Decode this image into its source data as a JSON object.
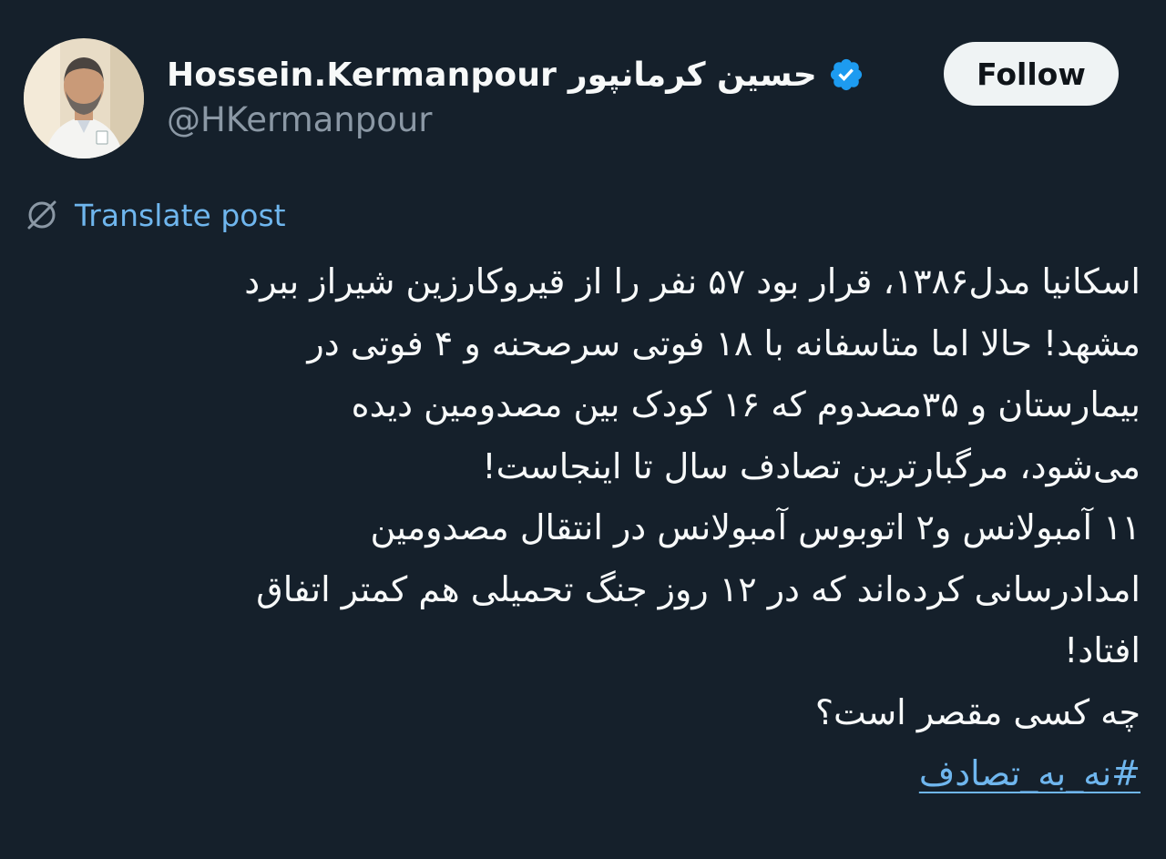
{
  "author": {
    "display_name": "Hossein.Kermanpour حسین کرمانپور",
    "handle": "@HKermanpour",
    "verified": true,
    "avatar": "avatar-photo",
    "verified_icon": "verified-badge-icon"
  },
  "follow_button": {
    "label": "Follow"
  },
  "translate": {
    "label": "Translate post",
    "icon": "globe-slash-icon"
  },
  "tweet": {
    "lines": [
      "اسکانیا مدل۱۳۸۶، قرار بود ۵۷ نفر را از قیروکارزین شیراز ببرد",
      "مشهد! حالا اما متاسفانه با ۱۸ فوتی سرصحنه و ۴ فوتی در",
      "بیمارستان و ۳۵مصدوم که ۱۶ کودک بین مصدومین دیده",
      "می‌شود، مرگبارترین تصادف سال تا اینجاست!",
      "۱۱ آمبولانس و۲ اتوبوس آمبولانس در انتقال مصدومین",
      "امدادرسانی کرده‌اند که در ۱۲ روز جنگ تحمیلی هم کمتر اتفاق",
      "افتاد!",
      "چه کسی مقصر است؟"
    ],
    "hashtag": "#نه_به_تصادف"
  },
  "colors": {
    "background": "#15202b",
    "text": "#f7f9f9",
    "secondary_text": "#8b98a5",
    "link": "#6fb6ee",
    "verified": "#1d9bf0",
    "button_bg": "#eff3f4",
    "button_text": "#0f1419"
  }
}
